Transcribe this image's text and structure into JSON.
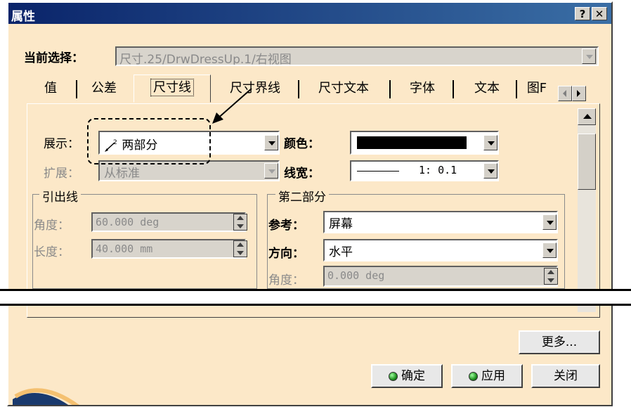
{
  "window": {
    "title": "属性",
    "help_label": "?",
    "close_label": "✕"
  },
  "selection": {
    "label": "当前选择：",
    "value": "尺寸.25/DrwDressUp.1/右视图"
  },
  "tabs": [
    {
      "label": "值"
    },
    {
      "label": "公差"
    },
    {
      "label": "尺寸线",
      "active": true
    },
    {
      "label": "尺寸界线"
    },
    {
      "label": "尺寸文本"
    },
    {
      "label": "字体"
    },
    {
      "label": "文本"
    },
    {
      "label": "图F"
    }
  ],
  "form": {
    "display": {
      "label": "展示：",
      "value": "两部分",
      "icon": "two-part-dimension-icon"
    },
    "extend": {
      "label": "扩展：",
      "value": "从标准"
    },
    "color": {
      "label": "颜色：",
      "value": "#000000"
    },
    "linewidth": {
      "label": "线宽：",
      "value": "1: 0.1"
    },
    "leader": {
      "title": "引出线",
      "angle": {
        "label": "角度：",
        "value": "60.000 deg"
      },
      "length": {
        "label": "长度：",
        "value": "40.000 mm"
      }
    },
    "second": {
      "title": "第二部分",
      "reference": {
        "label": "参考：",
        "value": "屏幕"
      },
      "direction": {
        "label": "方向：",
        "value": "水平"
      },
      "angle": {
        "label": "角度：",
        "value": "0.000 deg"
      }
    }
  },
  "buttons": {
    "more": "更多...",
    "ok": "确定",
    "apply": "应用",
    "close": "关闭"
  },
  "colors": {
    "titlebar": "#0a246a",
    "dialog_bg": "#fce8c8",
    "ok_indicator": "#1f8f1f"
  }
}
